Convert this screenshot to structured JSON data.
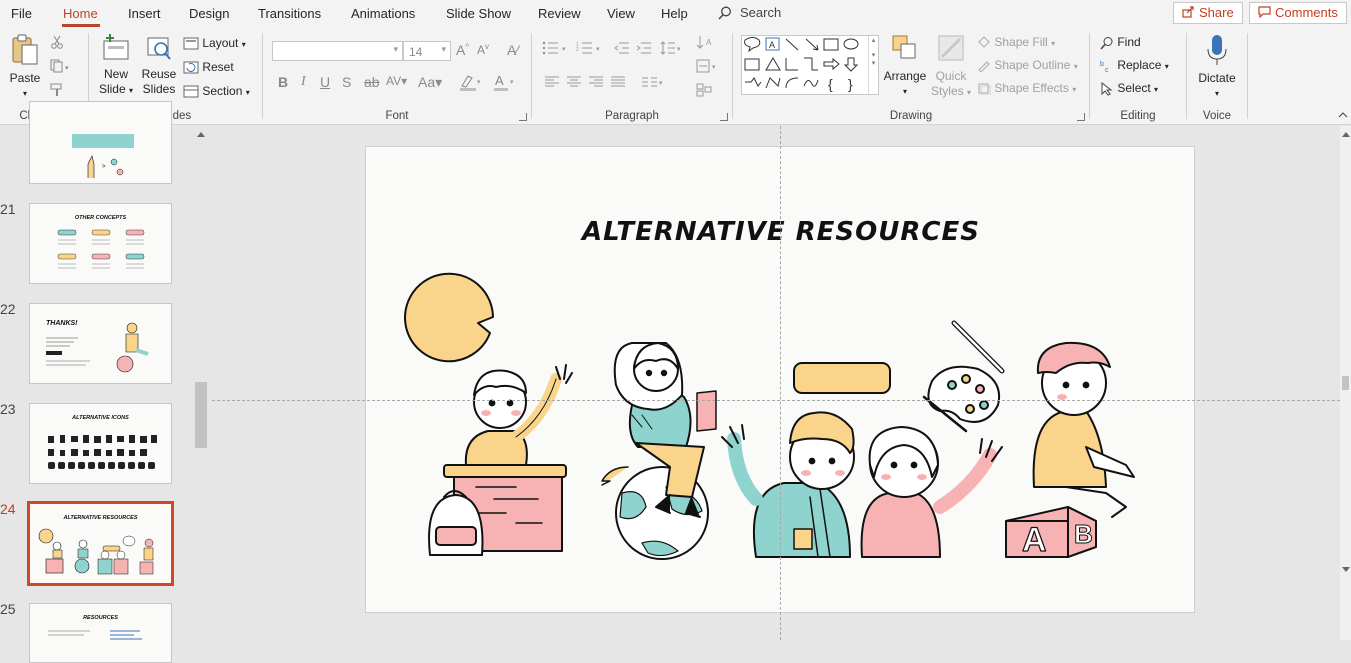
{
  "menu": {
    "tabs": [
      "File",
      "Home",
      "Insert",
      "Design",
      "Transitions",
      "Animations",
      "Slide Show",
      "Review",
      "View",
      "Help"
    ],
    "active_tab": "Home",
    "search_label": "Search",
    "share_label": "Share",
    "comments_label": "Comments"
  },
  "ribbon": {
    "clipboard": {
      "label": "Clipboard",
      "paste": "Paste"
    },
    "slides": {
      "label": "Slides",
      "new_slide_1": "New",
      "new_slide_2": "Slide",
      "reuse_1": "Reuse",
      "reuse_2": "Slides",
      "layout": "Layout",
      "reset": "Reset",
      "section": "Section"
    },
    "font": {
      "label": "Font",
      "size": "14"
    },
    "paragraph": {
      "label": "Paragraph"
    },
    "drawing": {
      "label": "Drawing",
      "arrange": "Arrange",
      "quick_1": "Quick",
      "quick_2": "Styles",
      "shape_fill": "Shape Fill",
      "shape_outline": "Shape Outline",
      "shape_effects": "Shape Effects"
    },
    "editing": {
      "label": "Editing",
      "find": "Find",
      "replace": "Replace",
      "select": "Select"
    },
    "voice": {
      "label": "Voice",
      "dictate": "Dictate"
    }
  },
  "thumbnails": [
    {
      "num": "",
      "title": ""
    },
    {
      "num": "21",
      "title": "OTHER CONCEPTS"
    },
    {
      "num": "22",
      "title": "THANKS!"
    },
    {
      "num": "23",
      "title": "ALTERNATIVE ICONS"
    },
    {
      "num": "24",
      "title": "ALTERNATIVE RESOURCES"
    },
    {
      "num": "25",
      "title": "RESOURCES"
    }
  ],
  "slide": {
    "title": "ALTERNATIVE RESOURCES"
  },
  "colors": {
    "accent": "#b7472a",
    "selected_border": "#d24726",
    "yellow": "#f9d48a",
    "pink": "#f7b3b3",
    "teal": "#8fd3ce",
    "ink": "#111111"
  }
}
